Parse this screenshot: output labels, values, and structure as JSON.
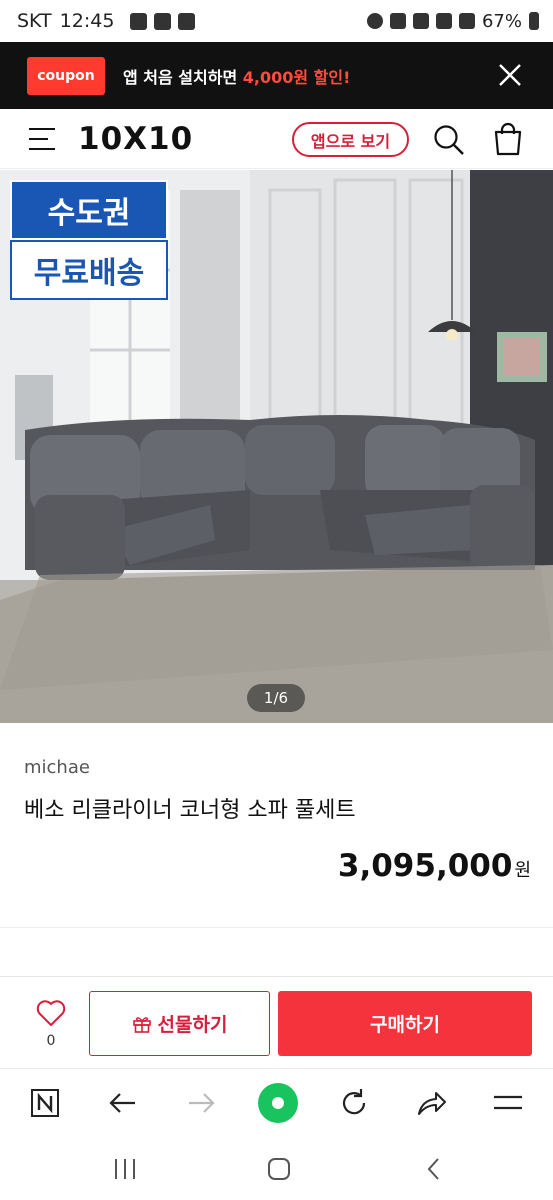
{
  "status_bar": {
    "carrier": "SKT",
    "time": "12:45",
    "battery": "67%"
  },
  "coupon_banner": {
    "badge": "coupon",
    "text_before": "앱 처음 설치하면 ",
    "text_highlight": "4,000원 할인!"
  },
  "header": {
    "logo": "10X10",
    "app_button": "앱으로 보기"
  },
  "product_image": {
    "badge_top": "수도권",
    "badge_bottom": "무료배송",
    "counter": "1/6"
  },
  "product": {
    "brand": "michae",
    "title": "베소 리클라이너 코너형 소파 풀세트",
    "price": "3,095,000",
    "currency": "원"
  },
  "purchase_bar": {
    "like_count": "0",
    "gift_label": "선물하기",
    "buy_label": "구매하기"
  },
  "colors": {
    "accent": "#f4333c",
    "brand_red": "#d6203b",
    "badge_blue": "#1a57b4",
    "browser_green": "#19c35e"
  }
}
